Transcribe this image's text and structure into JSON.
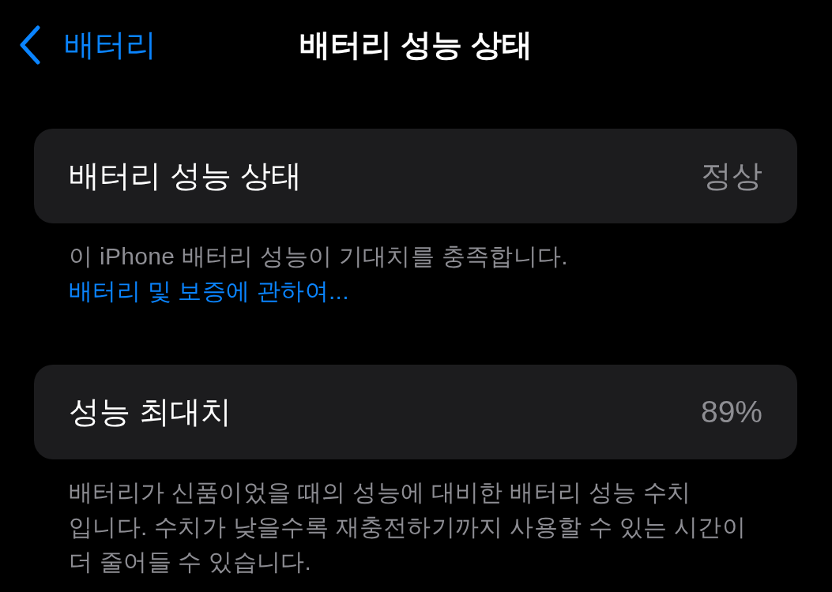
{
  "nav_bar": {
    "back_label": "배터리",
    "title": "배터리 성능 상태"
  },
  "sections": [
    {
      "label": "배터리 성능 상태",
      "value": "정상",
      "footer": "이 iPhone 배터리 성능이 기대치를 충족합니다.",
      "footer_link": "배터리 및 보증에 관하여..."
    },
    {
      "label": "성능 최대치",
      "value": "89%",
      "footer": "배터리가 신품이었을 때의 성능에 대비한 배터리 성능 수치 입니다. 수치가 낮을수록 재충전하기까지 사용할 수 있는 시간이 더 줄어들 수 있습니다."
    }
  ]
}
